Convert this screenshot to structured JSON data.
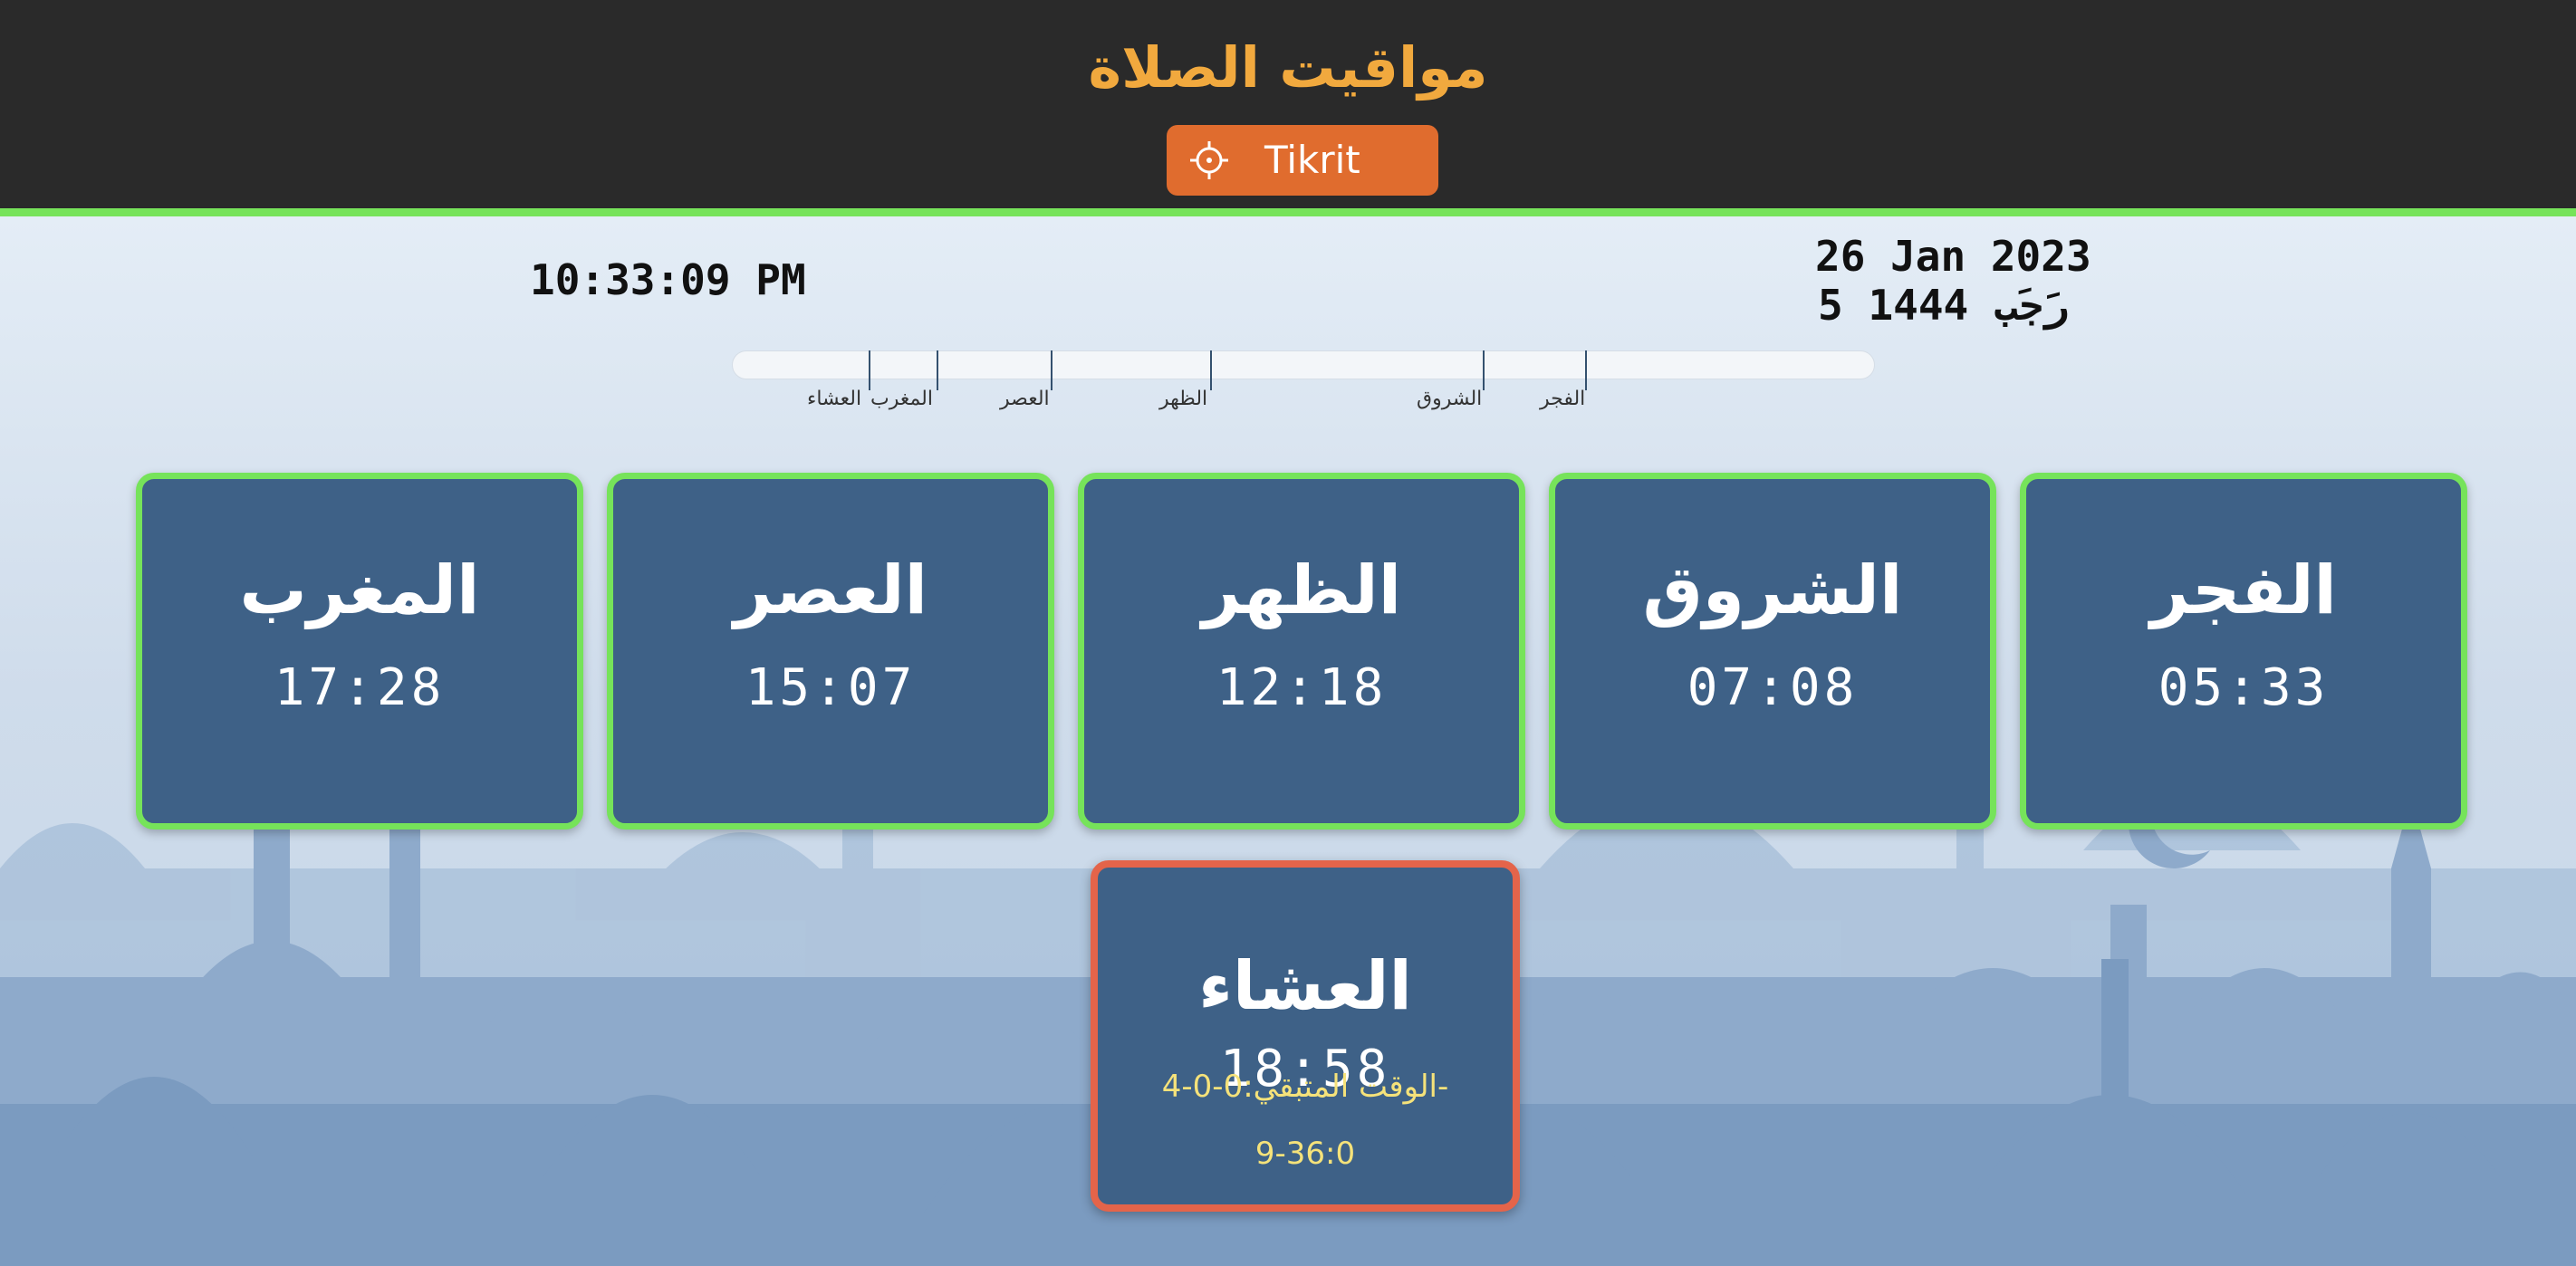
{
  "header": {
    "title": "مواقيت الصلاة",
    "location_button": {
      "label": "Tikrit",
      "icon": "crosshair-icon"
    }
  },
  "clock": {
    "time": "10:33:09 PM",
    "gregorian_date": "26 Jan 2023",
    "hijri_date": "رَجَب 1444 5"
  },
  "timeline": {
    "labels": {
      "isha": "العشاء",
      "maghrib": "المغرب",
      "asr": "العصر",
      "dhuhr": "الظهر",
      "sunrise": "الشروق",
      "fajr": "الفجر"
    }
  },
  "prayers": {
    "maghrib": {
      "name": "المغرب",
      "time": "17:28"
    },
    "asr": {
      "name": "العصر",
      "time": "15:07"
    },
    "dhuhr": {
      "name": "الظهر",
      "time": "12:18"
    },
    "sunrise": {
      "name": "الشروق",
      "time": "07:08"
    },
    "fajr": {
      "name": "الفجر",
      "time": "05:33"
    },
    "isha": {
      "name": "العشاء",
      "time": "18:58",
      "remaining_label": "الوقت المتبقي:0-0-4-",
      "remaining_value": "9-36:0"
    }
  },
  "colors": {
    "header_bg": "#2a2a2a",
    "title": "#f1a93e",
    "location_button": "#e06c2e",
    "card_bg": "#3e6187",
    "card_border": "#76e35a",
    "next_card_border": "#e4644a",
    "remaining_text": "#f5e27a"
  }
}
